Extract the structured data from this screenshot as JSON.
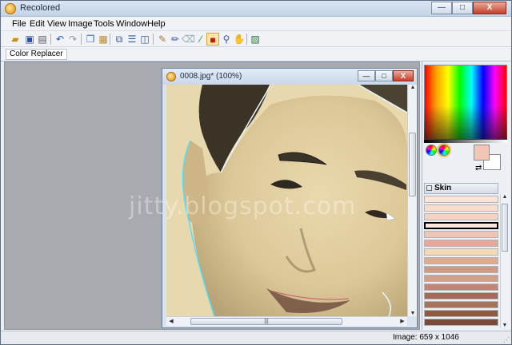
{
  "window": {
    "title": "Recolored",
    "buttons": {
      "minimize": "—",
      "maximize": "□",
      "close": "X"
    }
  },
  "menubar": [
    "File",
    "Edit",
    "View",
    "Image",
    "Tools",
    "Window",
    "Help"
  ],
  "toolbar": {
    "icons": [
      "open-icon",
      "save-icon",
      "print-icon",
      "undo-icon",
      "redo-icon",
      "copy-icon",
      "paste-icon",
      "cascade-icon",
      "tile-horizontal-icon",
      "tile-vertical-icon",
      "brush-icon",
      "pencil-icon",
      "eraser-icon",
      "eyedropper-icon",
      "color-replacer-icon",
      "zoom-icon",
      "hand-icon",
      "image-icon"
    ],
    "active_tool": "color-replacer-icon"
  },
  "tool_options": {
    "tool_name": "Color Replacer"
  },
  "image_window": {
    "title": "0008.jpg* (100%)",
    "buttons": {
      "minimize": "—",
      "maximize": "□",
      "close": "X"
    }
  },
  "palette": {
    "foreground_color": "#f2c6b4",
    "background_color": "#ffffff",
    "group_name": "Skin",
    "swatches": [
      "#fbe3d8",
      "#f8dccd",
      "#f5d2c2",
      "#fbe6dc",
      "#f0c4b4",
      "#e7a79a",
      "#f4d9b4",
      "#e0ab8c",
      "#cf9a84",
      "#d2a08a",
      "#c48478",
      "#a66a5a",
      "#a6725a",
      "#8e5a40",
      "#7a4a38"
    ],
    "selected_index": 3
  },
  "status": {
    "image_size": "Image: 659 x 1046"
  },
  "watermark": "jitty.blogspot.com"
}
